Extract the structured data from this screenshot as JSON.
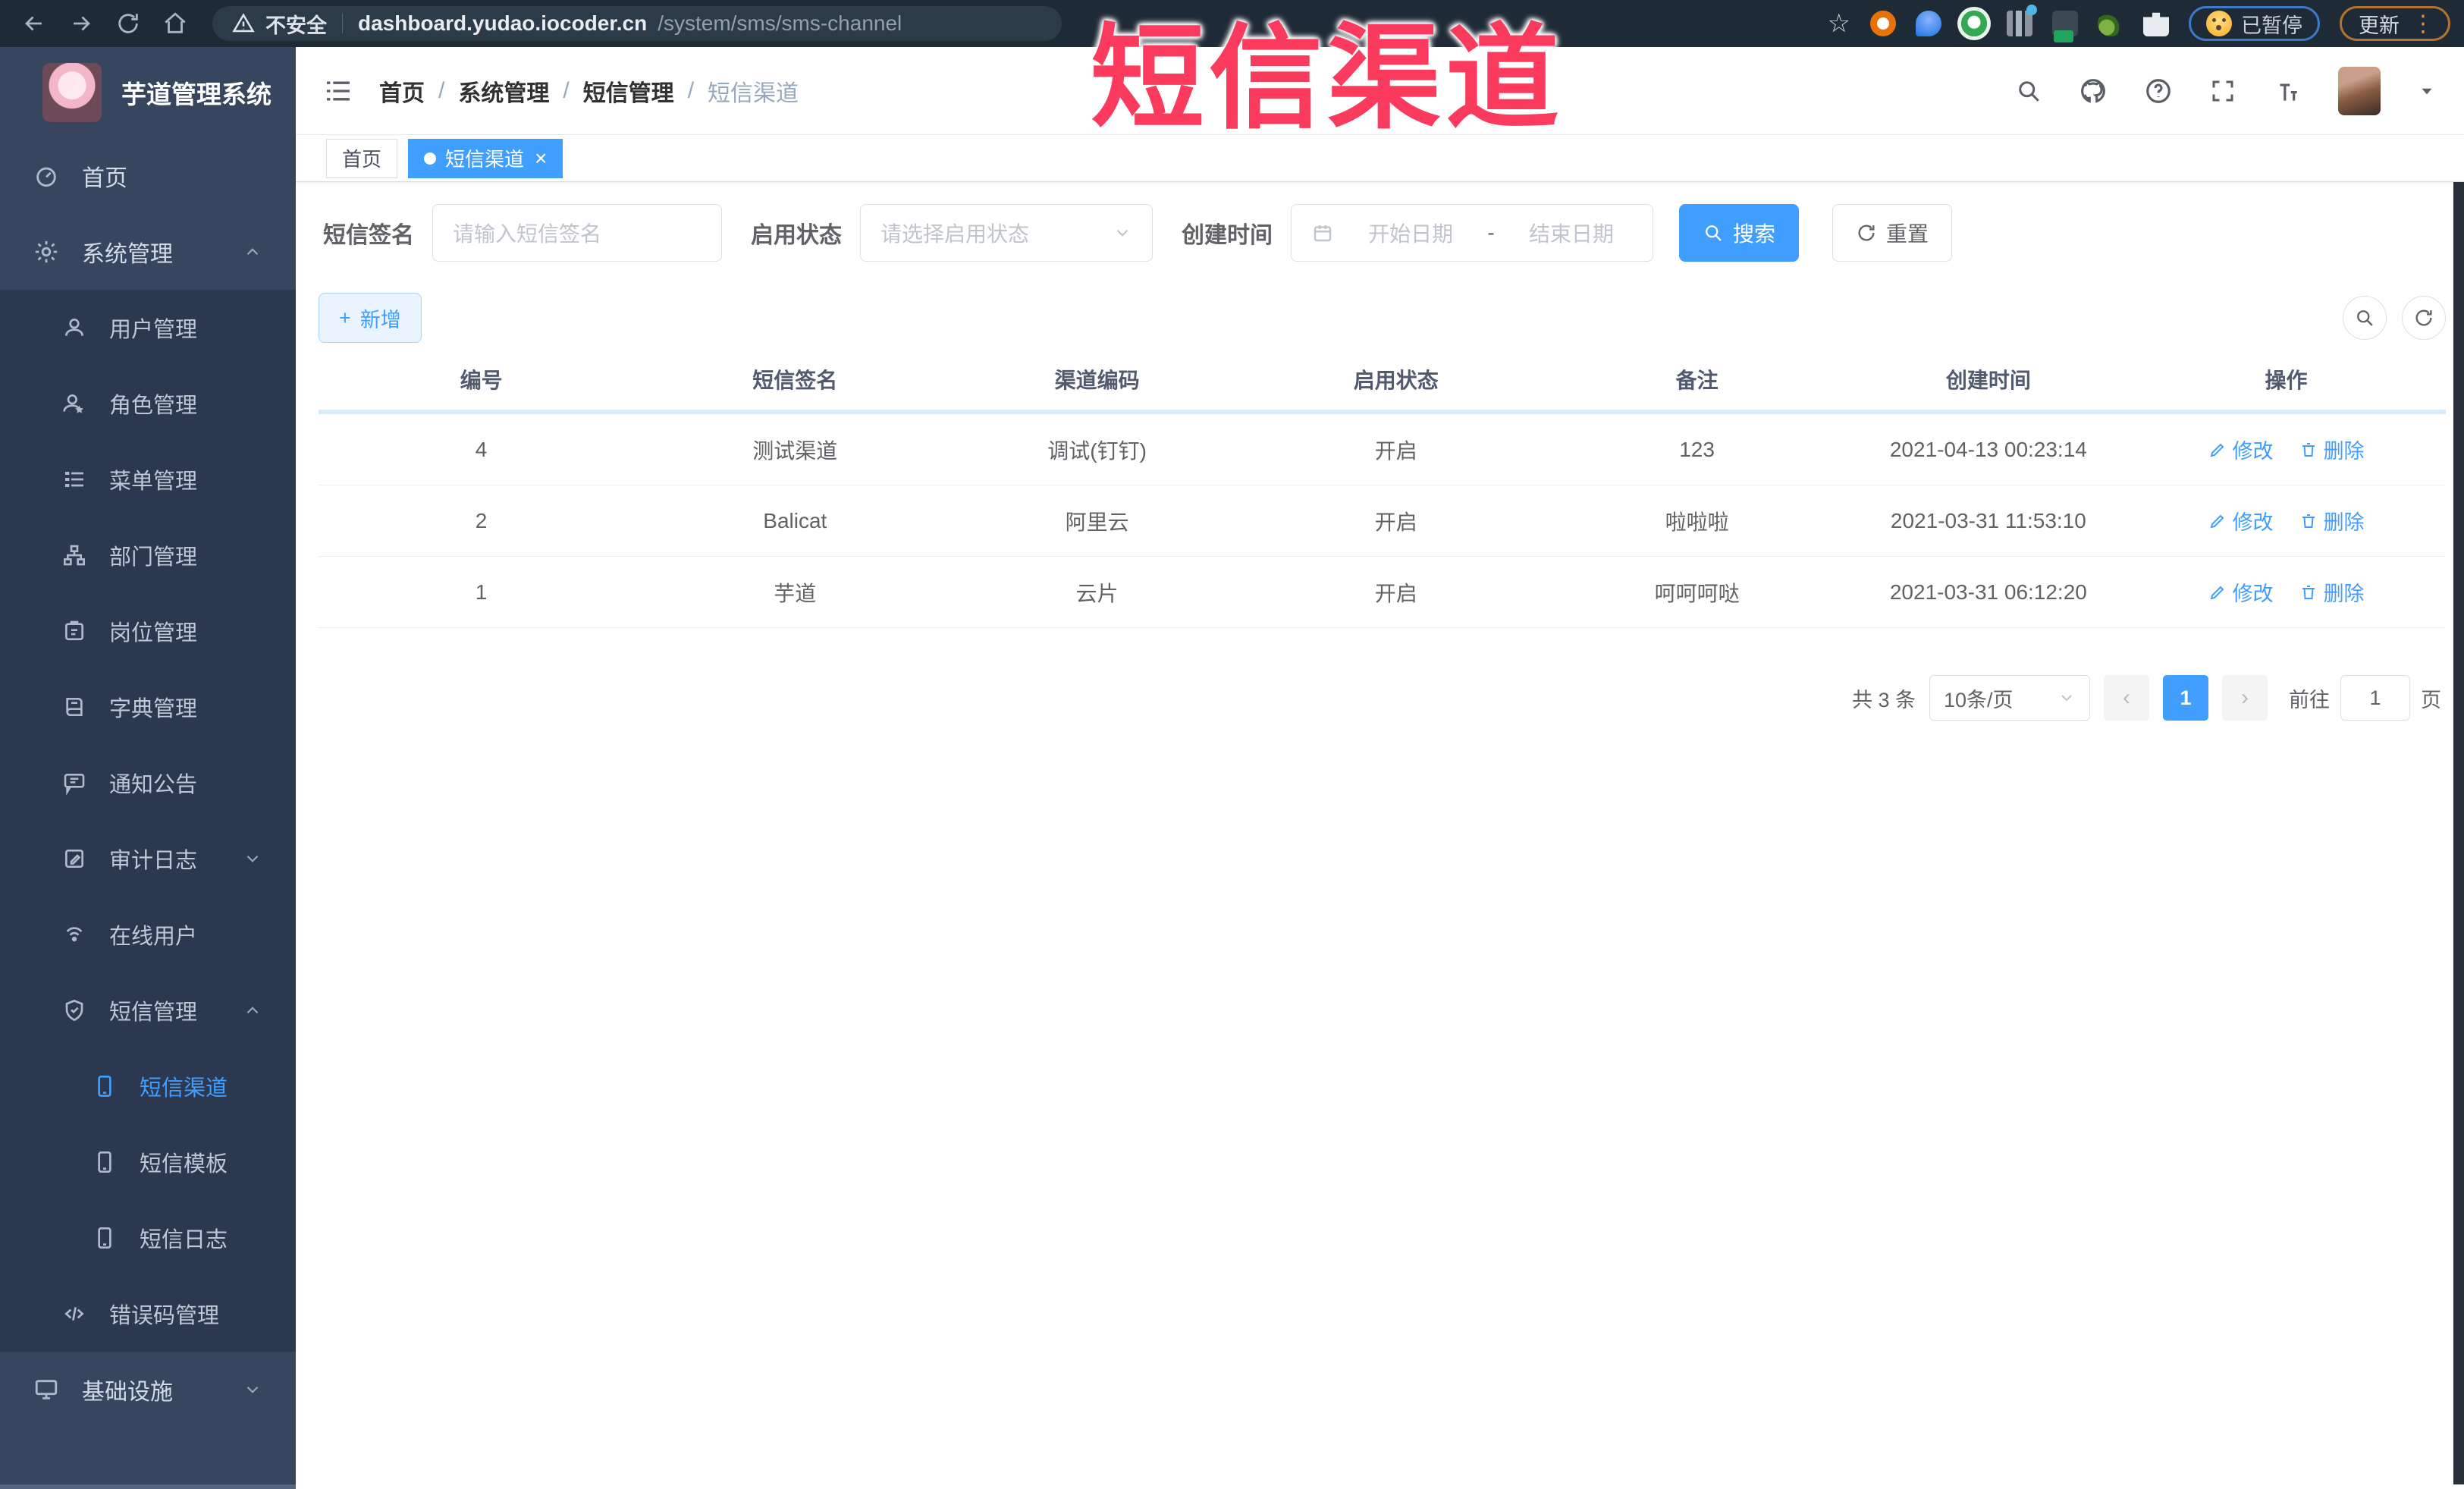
{
  "colors": {
    "accent": "#409eff",
    "annotation_red": "#fa3b5e",
    "sidebar_bg": "#37455f",
    "submenu_bg": "#2b3850",
    "chrome_bg": "#1f2a37"
  },
  "annotation": {
    "text": "短信渠道"
  },
  "browser": {
    "security_label": "不安全",
    "url_domain": "dashboard.yudao.iocoder.cn",
    "url_path": "/system/sms/sms-channel",
    "paused_label": "已暂停",
    "update_label": "更新"
  },
  "icons": {
    "star": "☆",
    "dots": "⋮",
    "close": "×",
    "prev": "‹",
    "next": "›",
    "plus": "+"
  },
  "sidebar": {
    "brand": "芋道管理系统",
    "items": [
      {
        "label": "首页"
      },
      {
        "label": "系统管理"
      },
      {
        "label": "用户管理"
      },
      {
        "label": "角色管理"
      },
      {
        "label": "菜单管理"
      },
      {
        "label": "部门管理"
      },
      {
        "label": "岗位管理"
      },
      {
        "label": "字典管理"
      },
      {
        "label": "通知公告"
      },
      {
        "label": "审计日志"
      },
      {
        "label": "在线用户"
      },
      {
        "label": "短信管理"
      },
      {
        "label": "短信渠道"
      },
      {
        "label": "短信模板"
      },
      {
        "label": "短信日志"
      },
      {
        "label": "错误码管理"
      },
      {
        "label": "基础设施"
      }
    ]
  },
  "header": {
    "breadcrumb": [
      {
        "label": "首页"
      },
      {
        "label": "系统管理"
      },
      {
        "label": "短信管理"
      },
      {
        "label": "短信渠道"
      }
    ],
    "separator": "/"
  },
  "tags": [
    {
      "label": "首页"
    },
    {
      "label": "短信渠道"
    }
  ],
  "filter": {
    "sign_label": "短信签名",
    "sign_placeholder": "请输入短信签名",
    "status_label": "启用状态",
    "status_placeholder": "请选择启用状态",
    "time_label": "创建时间",
    "start_placeholder": "开始日期",
    "range_separator": "-",
    "end_placeholder": "结束日期",
    "search_label": "搜索",
    "reset_label": "重置"
  },
  "toolbar": {
    "add_label": "新增"
  },
  "table": {
    "headers": [
      "编号",
      "短信签名",
      "渠道编码",
      "启用状态",
      "备注",
      "创建时间",
      "操作"
    ],
    "actions": {
      "edit": "修改",
      "delete": "删除"
    },
    "rows": [
      {
        "id": "4",
        "sign": "测试渠道",
        "code": "调试(钉钉)",
        "status": "开启",
        "remark": "123",
        "time": "2021-04-13 00:23:14"
      },
      {
        "id": "2",
        "sign": "Balicat",
        "code": "阿里云",
        "status": "开启",
        "remark": "啦啦啦",
        "time": "2021-03-31 11:53:10"
      },
      {
        "id": "1",
        "sign": "芋道",
        "code": "云片",
        "status": "开启",
        "remark": "呵呵呵哒",
        "time": "2021-03-31 06:12:20"
      }
    ]
  },
  "pagination": {
    "total": "共 3 条",
    "page_size": "10条/页",
    "current_page": "1",
    "goto_label": "前往",
    "goto_value": "1",
    "unit_label": "页"
  }
}
